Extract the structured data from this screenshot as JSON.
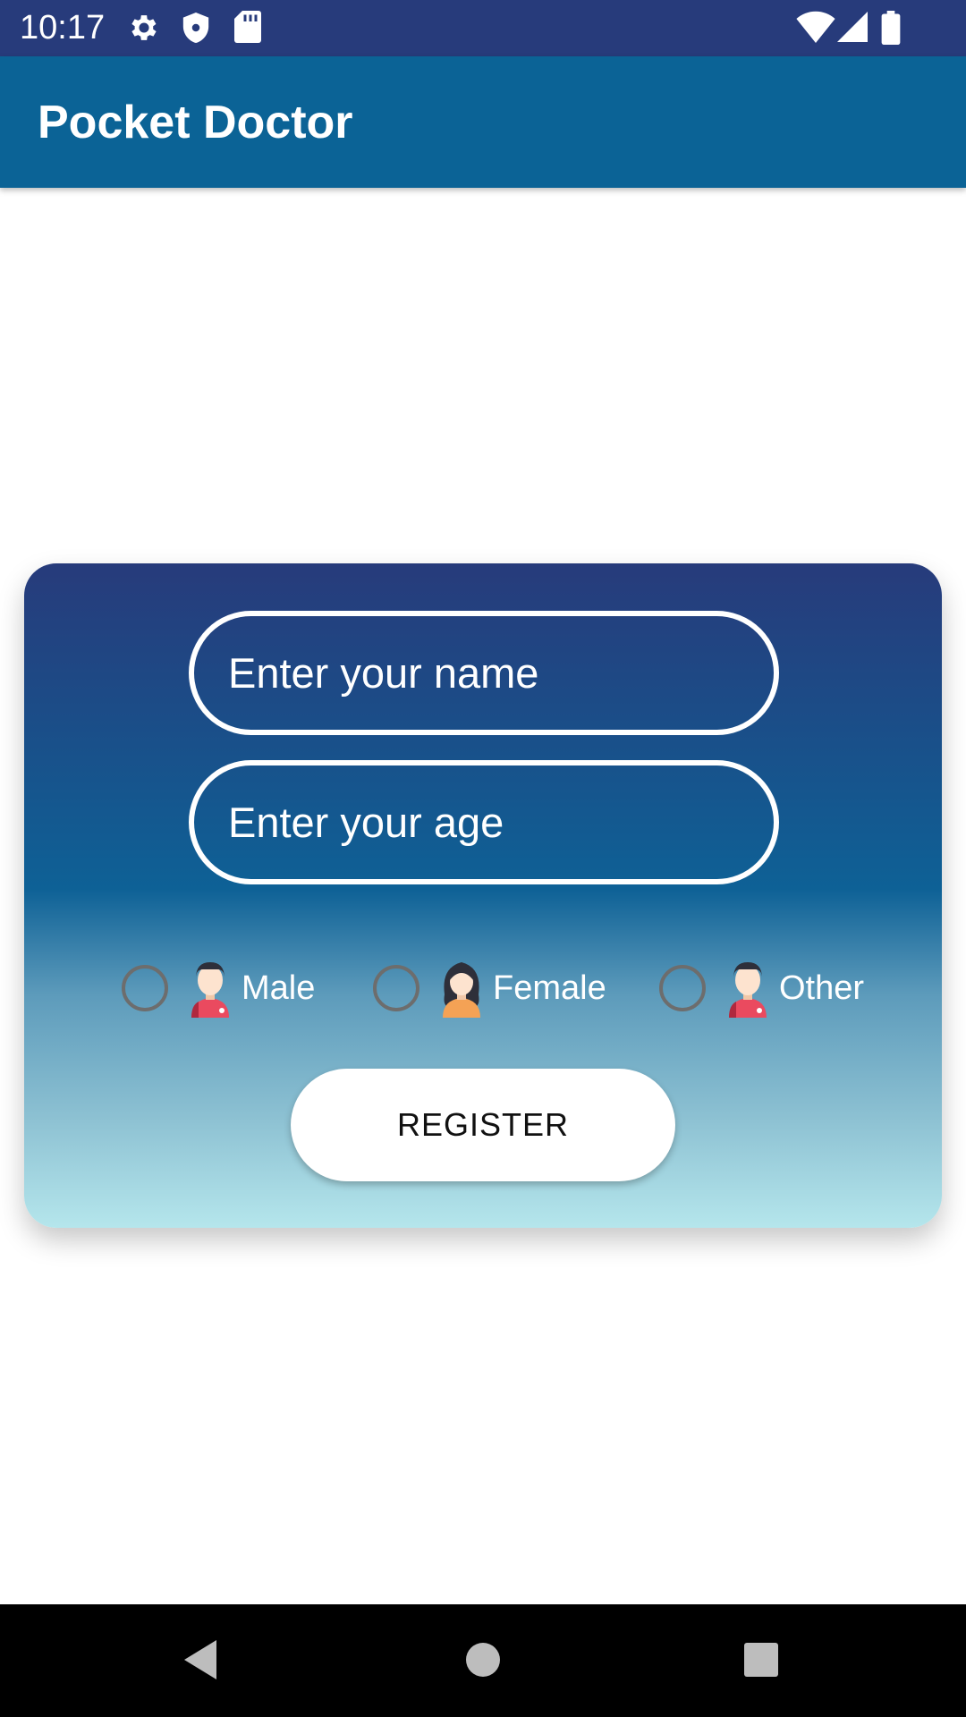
{
  "status_bar": {
    "time": "10:17",
    "icons": [
      "gear-icon",
      "shield-icon",
      "sd-card-icon",
      "wifi-icon",
      "signal-icon",
      "battery-icon"
    ]
  },
  "app_bar": {
    "title": "Pocket Doctor"
  },
  "form": {
    "name_placeholder": "Enter your name",
    "age_placeholder": "Enter your age",
    "gender_options": [
      {
        "label": "Male",
        "icon": "male-avatar-icon",
        "selected": false
      },
      {
        "label": "Female",
        "icon": "female-avatar-icon",
        "selected": false
      },
      {
        "label": "Other",
        "icon": "other-avatar-icon",
        "selected": false
      }
    ],
    "register_label": "REGISTER"
  },
  "nav_bar": {
    "buttons": [
      "back-icon",
      "home-icon",
      "recents-icon"
    ]
  },
  "colors": {
    "status_bar": "#273b7b",
    "app_bar": "#0b6396",
    "card_gradient_top": "#273b7b",
    "card_gradient_mid": "#0e6196",
    "card_gradient_bottom": "#b5e6ec"
  }
}
